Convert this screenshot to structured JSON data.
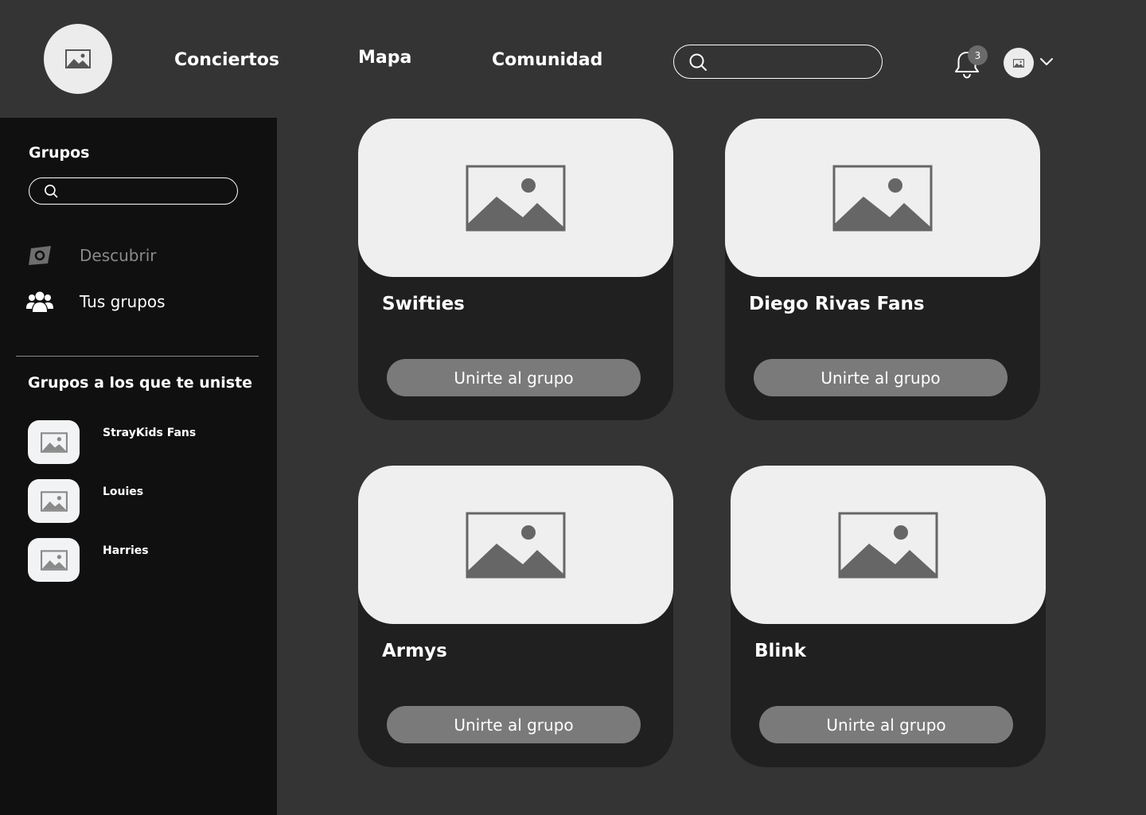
{
  "header": {
    "logo_icon": "image-placeholder-icon",
    "nav": [
      {
        "label": "Conciertos"
      },
      {
        "label": "Mapa"
      },
      {
        "label": "Comunidad"
      }
    ],
    "search": {
      "placeholder": "",
      "value": "",
      "icon": "search-icon"
    },
    "notifications": {
      "icon": "bell-icon",
      "count": "3"
    },
    "profile": {
      "icon": "image-placeholder-icon",
      "menu_icon": "chevron-down-icon"
    }
  },
  "sidebar": {
    "title": "Grupos",
    "search": {
      "placeholder": "",
      "value": "",
      "icon": "search-icon"
    },
    "nav": [
      {
        "label": "Descubrir",
        "icon": "compass-icon",
        "state": "inactive"
      },
      {
        "label": "Tus grupos",
        "icon": "users-icon",
        "state": "active"
      }
    ],
    "joined_title": "Grupos a los que te uniste",
    "joined_groups": [
      {
        "label": "StrayKids Fans",
        "icon": "image-placeholder-icon"
      },
      {
        "label": "Louies",
        "icon": "image-placeholder-icon"
      },
      {
        "label": "Harries",
        "icon": "image-placeholder-icon"
      }
    ]
  },
  "groups": [
    {
      "title": "Swifties",
      "button": "Unirte al grupo"
    },
    {
      "title": "Diego Rivas Fans",
      "button": "Unirte al grupo"
    },
    {
      "title": "Armys",
      "button": "Unirte al grupo"
    },
    {
      "title": "Blink",
      "button": "Unirte al grupo"
    }
  ],
  "colors": {
    "page_bg": "#343434",
    "sidebar_bg": "#111010",
    "card_bg": "#202020",
    "image_placeholder_bg": "#efefef",
    "button_bg": "#7a7a7a",
    "muted_text": "#8a8a8a"
  }
}
